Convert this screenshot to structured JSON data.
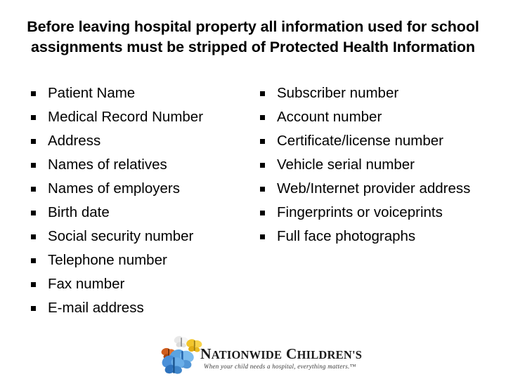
{
  "slide": {
    "background_color": "#ffffff",
    "text_color": "#000000",
    "title": "Before leaving hospital property all information used for school assignments must be stripped of Protected Health Information"
  },
  "bullet_icon": "small-square-bullet",
  "left_column": {
    "items": [
      {
        "label": "Patient Name"
      },
      {
        "label": "Medical Record Number"
      },
      {
        "label": "Address"
      },
      {
        "label": "Names of relatives"
      },
      {
        "label": "Names of employers"
      },
      {
        "label": "Birth date"
      },
      {
        "label": "Social security number"
      },
      {
        "label": "Telephone number"
      },
      {
        "label": "Fax number"
      },
      {
        "label": "E-mail address"
      }
    ]
  },
  "right_column": {
    "items": [
      {
        "label": "Subscriber number"
      },
      {
        "label": "Account number"
      },
      {
        "label": "Certificate/license number"
      },
      {
        "label": "Vehicle serial number"
      },
      {
        "label": "Web/Internet provider address"
      },
      {
        "label": "Fingerprints or voiceprints"
      },
      {
        "label": "Full face photographs"
      }
    ]
  },
  "logo": {
    "wordmark_part1_cap": "N",
    "wordmark_part1_rest": "ATIONWIDE",
    "wordmark_part2_cap": "C",
    "wordmark_part2_rest": "HILDREN'S",
    "tagline": "When your child needs a hospital, everything matters.™",
    "butterfly_colors": {
      "blue": "#4a90d9",
      "blue_dark": "#1f5fa8",
      "yellow": "#f0c020",
      "orange": "#d4601e",
      "white": "#f2f2f2"
    }
  }
}
